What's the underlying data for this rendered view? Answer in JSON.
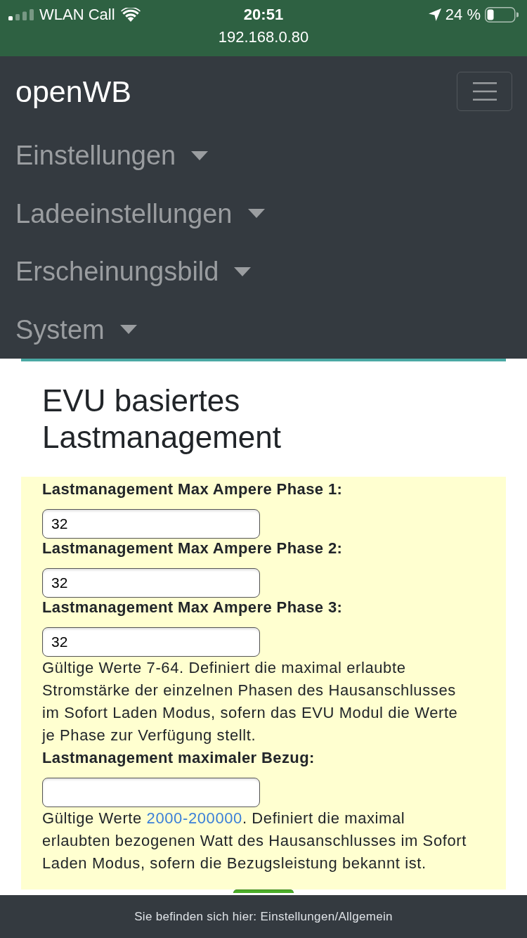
{
  "status_bar": {
    "carrier": "WLAN Call",
    "time": "20:51",
    "battery": "24 %",
    "url": "192.168.0.80"
  },
  "navbar": {
    "brand": "openWB",
    "menu": [
      {
        "label": "Einstellungen"
      },
      {
        "label": "Ladeeinstellungen"
      },
      {
        "label": "Erscheinungsbild"
      },
      {
        "label": "System"
      }
    ]
  },
  "section": {
    "title": "EVU basiertes Lastmanagement",
    "items": [
      {
        "kind": "field",
        "label": "Lastmanagement Max Ampere Phase 1:",
        "value": "32"
      },
      {
        "kind": "field",
        "label": "Lastmanagement Max Ampere Phase 2:",
        "value": "32"
      },
      {
        "kind": "field",
        "label": "Lastmanagement Max Ampere Phase 3:",
        "value": "32"
      },
      {
        "kind": "help",
        "text": "Gültige Werte 7-64. Definiert die maximal erlaubte Stromstärke der einzelnen Phasen des Hausanschlusses im Sofort Laden Modus, sofern das EVU Modul die Werte je Phase zur Verfügung stellt."
      },
      {
        "kind": "field",
        "label": "Lastmanagement maximaler Bezug:"
      },
      {
        "kind": "help",
        "text": "Gültige Werte ",
        "link": "2000-200000",
        "text_after": ". Definiert die maximal erlaubten bezogenen Watt des Hausanschlusses im Sofort Laden Modus, sofern die Bezugsleistung bekannt ist."
      }
    ]
  },
  "footer": {
    "text": "Sie befinden sich hier: Einstellungen/Allgemein"
  }
}
